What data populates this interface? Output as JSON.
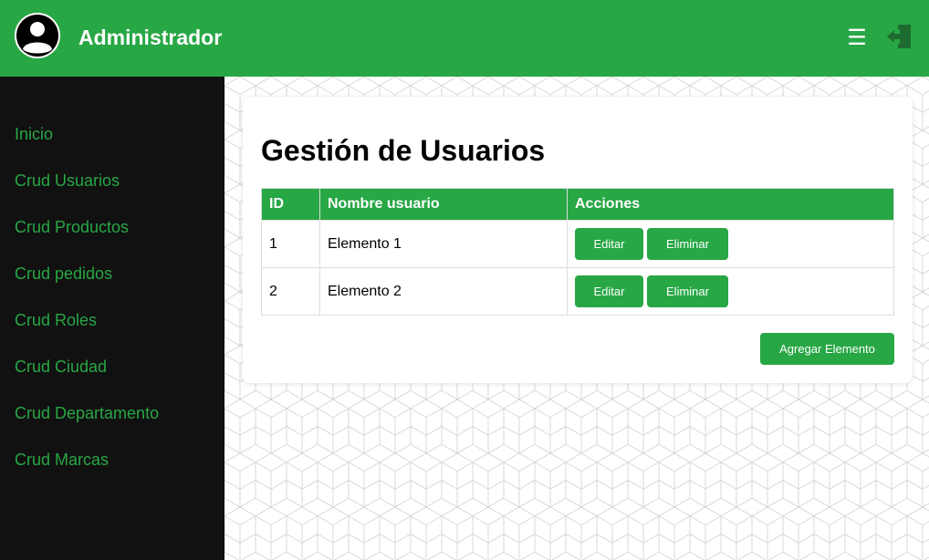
{
  "header": {
    "title": "Administrador",
    "menu_glyph": "☰"
  },
  "sidebar": {
    "items": [
      {
        "label": "Inicio"
      },
      {
        "label": "Crud Usuarios"
      },
      {
        "label": "Crud Productos"
      },
      {
        "label": "Crud pedidos"
      },
      {
        "label": "Crud Roles"
      },
      {
        "label": "Crud Ciudad"
      },
      {
        "label": "Crud Departamento"
      },
      {
        "label": "Crud Marcas"
      }
    ]
  },
  "main": {
    "title": "Gestión de Usuarios",
    "table": {
      "headers": [
        "ID",
        "Nombre usuario",
        "Acciones"
      ],
      "rows": [
        {
          "id": "1",
          "name": "Elemento 1",
          "edit": "Editar",
          "delete": "Eliminar"
        },
        {
          "id": "2",
          "name": "Elemento 2",
          "edit": "Editar",
          "delete": "Eliminar"
        }
      ]
    },
    "add_button": "Agregar Elemento"
  },
  "colors": {
    "brand": "#28a745",
    "sidebar_bg": "#111111"
  },
  "icons": [
    "user-avatar-icon",
    "hamburger-menu-icon",
    "logout-icon"
  ]
}
